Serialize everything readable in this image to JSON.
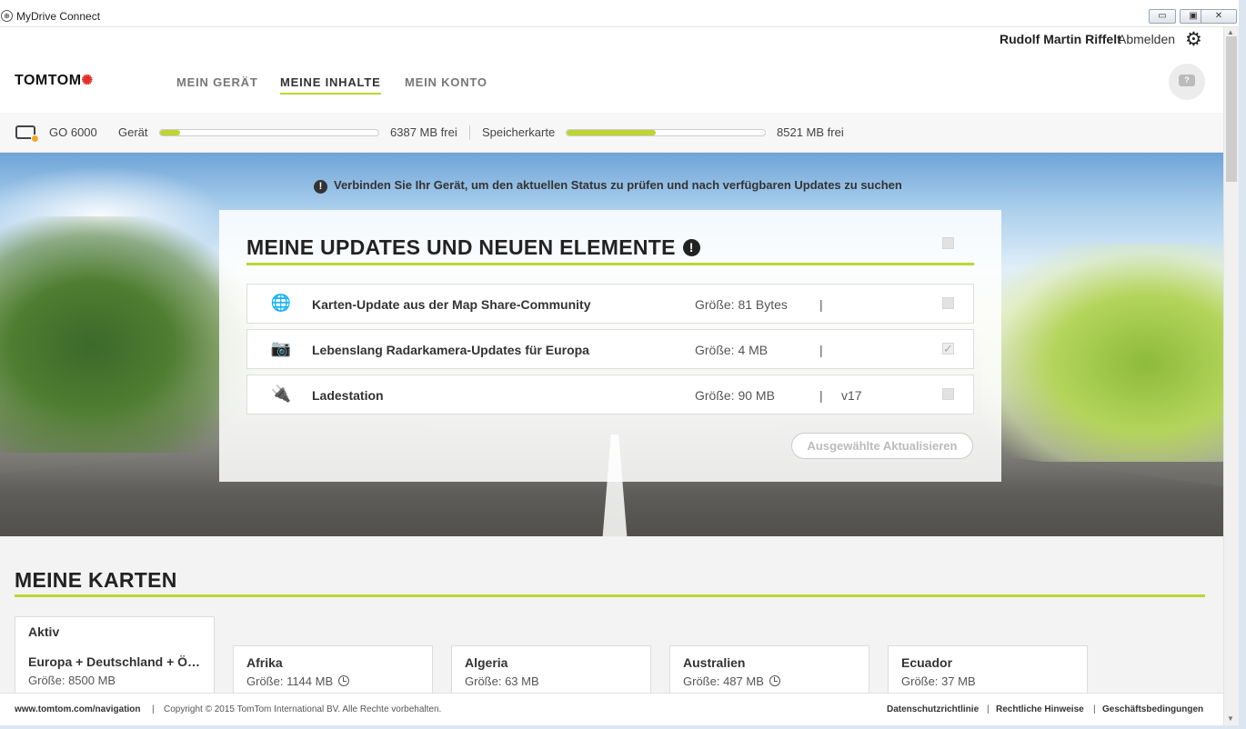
{
  "window": {
    "title": "MyDrive Connect",
    "min": "▭",
    "max": "▣",
    "close": "✕"
  },
  "header": {
    "user": "Rudolf Martin Riffelt",
    "logout": "Abmelden",
    "logo": "TOMTOM",
    "nav": [
      "MEIN GERÄT",
      "MEINE INHALTE",
      "MEIN KONTO"
    ],
    "help_icon": "?"
  },
  "device": {
    "name": "GO 6000",
    "device_label": "Gerät",
    "device_fill": 0.09,
    "device_free": "6387 MB  frei",
    "card_label": "Speicherkarte",
    "card_fill": 0.45,
    "card_free": "8521 MB  frei"
  },
  "hero": {
    "message": "Verbinden Sie Ihr Gerät, um den aktuellen Status zu prüfen und nach verfügbaren Updates zu suchen",
    "warn_icon": "!",
    "panel_title": "MEINE UPDATES UND NEUEN ELEMENTE",
    "updates": [
      {
        "icon": "globe-icon",
        "glyph": "🌐",
        "name": "Karten-Update aus der Map Share-Community",
        "size": "Größe:  81 Bytes",
        "pipe": "|",
        "version": "",
        "checked": false
      },
      {
        "icon": "speed-camera-icon",
        "glyph": "📷",
        "name": "Lebenslang Radarkamera-Updates für Europa",
        "size": "Größe:  4 MB",
        "pipe": "|",
        "version": "",
        "checked": true
      },
      {
        "icon": "charging-station-icon",
        "glyph": "🔌",
        "name": "Ladestation",
        "size": "Größe:  90 MB",
        "pipe": "|",
        "version": "v17",
        "checked": false
      }
    ],
    "update_button": "Ausgewählte Aktualisieren",
    "check_mark": "✓"
  },
  "maps": {
    "title": "MEINE KARTEN",
    "active_tab": "Aktiv",
    "cards": [
      {
        "name": "Europa + Deutschland + Ö…",
        "size": "Größe:  8500 MB",
        "clock": false
      },
      {
        "name": "Afrika",
        "size": "Größe:  1144 MB",
        "clock": true
      },
      {
        "name": "Algeria",
        "size": "Größe:  63 MB",
        "clock": false
      },
      {
        "name": "Australien",
        "size": "Größe:  487 MB",
        "clock": true
      },
      {
        "name": "Ecuador",
        "size": "Größe:  37 MB",
        "clock": false
      }
    ]
  },
  "footer": {
    "link": "www.tomtom.com/navigation",
    "pipe": "|",
    "copyright": "Copyright © 2015 TomTom International BV. Alle Rechte vorbehalten.",
    "privacy": "Datenschutzrichtlinie",
    "legal": "Rechtliche Hinweise",
    "terms": "Geschäftsbedingungen"
  },
  "colors": {
    "accent": "#bcd534",
    "brand_red": "#e22e28"
  }
}
